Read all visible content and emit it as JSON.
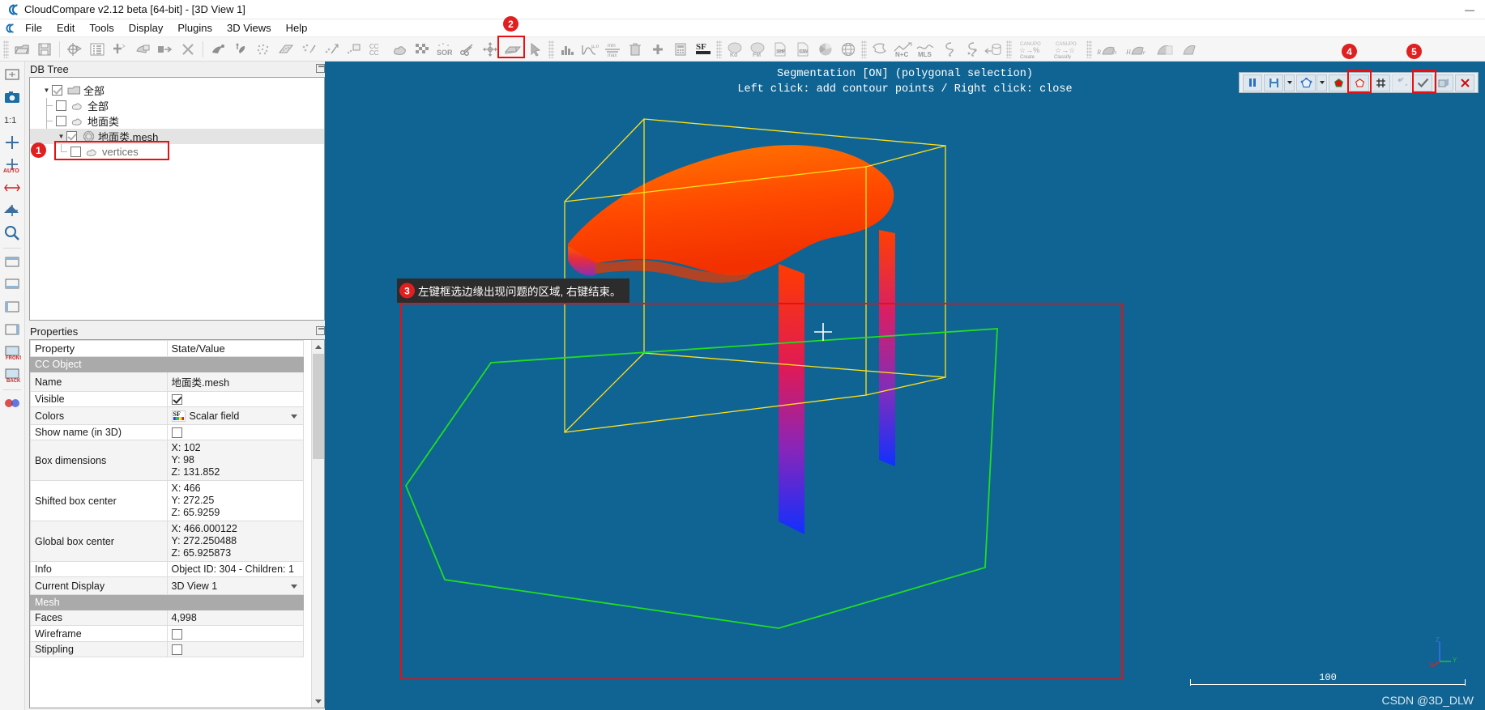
{
  "window": {
    "title": "CloudCompare v2.12 beta [64-bit] - [3D View 1]",
    "app_icon": "cloudcompare-logo-icon",
    "minimize": "—",
    "maximize": "▢",
    "close": "✕"
  },
  "menubar": {
    "icon": "cloudcompare-logo-icon",
    "items": [
      {
        "label": "File",
        "mnemonic": "F"
      },
      {
        "label": "Edit",
        "mnemonic": "E"
      },
      {
        "label": "Tools",
        "mnemonic": "T"
      },
      {
        "label": "Display",
        "mnemonic": "D"
      },
      {
        "label": "Plugins",
        "mnemonic": "P"
      },
      {
        "label": "3D Views",
        "mnemonic": "V"
      },
      {
        "label": "Help",
        "mnemonic": "H"
      }
    ]
  },
  "main_toolbar": {
    "groups": [
      {
        "buttons": [
          {
            "name": "open-file-icon"
          },
          {
            "name": "save-file-icon"
          }
        ]
      },
      {
        "buttons": [
          {
            "name": "global-shift-settings-icon"
          },
          {
            "name": "display-properties-icon"
          },
          {
            "name": "add-point-icon"
          },
          {
            "name": "clone-icon"
          },
          {
            "name": "merge-icon"
          },
          {
            "name": "delete-icon"
          }
        ]
      },
      {
        "buttons": [
          {
            "name": "subsample-icon"
          },
          {
            "name": "normals-icon"
          },
          {
            "name": "sample-points-icon"
          },
          {
            "name": "rasterize-icon"
          },
          {
            "name": "noise-filter-icon"
          },
          {
            "name": "compute-unroll-icon"
          },
          {
            "name": "fit-plane-icon"
          },
          {
            "name": "cloud-cloud-dist-icon"
          },
          {
            "name": "cloud-mesh-dist-icon"
          },
          {
            "name": "checkerboard-icon"
          },
          {
            "name": "sor-filter-icon"
          },
          {
            "name": "segment-scissors-icon",
            "highlighted": true
          },
          {
            "name": "translate-rotate-icon"
          },
          {
            "name": "section-box-icon"
          },
          {
            "name": "point-picking-icon"
          }
        ]
      },
      {
        "buttons": [
          {
            "name": "histogram-icon"
          },
          {
            "name": "gaussian-filter-icon"
          },
          {
            "name": "filter-by-value-icon"
          },
          {
            "name": "sf-gradient-icon"
          },
          {
            "name": "delete-sf-icon"
          },
          {
            "name": "add-sf-icon"
          },
          {
            "name": "sf-arithmetic-icon"
          },
          {
            "name": "sf-toolbar-icon"
          }
        ]
      },
      {
        "buttons": [
          {
            "name": "kd-tree-icon",
            "label": "Kd"
          },
          {
            "name": "fm-plugin-icon",
            "label": "FM"
          },
          {
            "name": "export-shp-icon",
            "label": "SHP"
          },
          {
            "name": "export-csv-icon",
            "label": "CSV"
          },
          {
            "name": "pie-chart-icon"
          },
          {
            "name": "globe-icon"
          }
        ]
      },
      {
        "buttons": [
          {
            "name": "puzzle-plugin-icon"
          },
          {
            "name": "normal-to-cloud-icon",
            "label": "N+C"
          },
          {
            "name": "mls-plugin-icon",
            "label": "MLS"
          },
          {
            "name": "curvature-icon"
          },
          {
            "name": "ransac-shape-detect-icon"
          },
          {
            "name": "unroll-cylinder-icon"
          }
        ]
      },
      {
        "buttons": [
          {
            "name": "canupo-create-icon",
            "label": "CANUPO Create"
          },
          {
            "name": "canupo-classify-icon",
            "label": "CANUPO Classify"
          }
        ]
      },
      {
        "buttons": [
          {
            "name": "rgb-render-icon",
            "label": "RGB"
          },
          {
            "name": "hsv-render-icon",
            "label": "HSV"
          },
          {
            "name": "shade-render-icon"
          },
          {
            "name": "ambient-render-icon"
          }
        ]
      }
    ]
  },
  "left_strip": {
    "buttons": [
      {
        "name": "zoom-global-icon"
      },
      {
        "name": "camera-snapshot-icon"
      },
      {
        "name": "zoom-1-1-icon",
        "label": "1:1"
      },
      {
        "name": "pivot-center-icon"
      },
      {
        "name": "auto-pivot-icon",
        "label": "AUTO"
      },
      {
        "name": "object-camera-mode-icon"
      },
      {
        "name": "pick-rotation-center-icon"
      },
      {
        "name": "zoom-window-icon"
      },
      {
        "name": "view-top-icon"
      },
      {
        "name": "view-bottom-icon"
      },
      {
        "name": "view-left-icon"
      },
      {
        "name": "view-right-icon"
      },
      {
        "name": "view-front-icon",
        "label": "FRONT"
      },
      {
        "name": "view-back-icon",
        "label": "BACK"
      },
      {
        "name": "stereo-mode-icon"
      }
    ]
  },
  "db_tree": {
    "title": "DB Tree",
    "float_icon": "undock-icon",
    "items": [
      {
        "label": "全部",
        "icon": "folder-icon",
        "checked": true,
        "expanded": true,
        "depth": 0,
        "selected": false,
        "checkbox_gray": true
      },
      {
        "label": "全部",
        "icon": "cloud-icon",
        "checked": false,
        "depth": 1,
        "selected": false
      },
      {
        "label": "地面类",
        "icon": "cloud-icon",
        "checked": false,
        "depth": 1,
        "selected": false
      },
      {
        "label": "地面类.mesh",
        "icon": "mesh-icon",
        "checked": true,
        "expanded": true,
        "depth": 1,
        "selected": true,
        "checkbox_gray": true
      },
      {
        "label": "vertices",
        "icon": "cloud-icon",
        "checked": false,
        "depth": 2,
        "selected": false
      }
    ]
  },
  "properties": {
    "title": "Properties",
    "float_icon": "undock-icon",
    "columns": [
      "Property",
      "State/Value"
    ],
    "rows": [
      {
        "type": "section",
        "label": "CC Object"
      },
      {
        "type": "text",
        "key": "Name",
        "value": "地面类.mesh"
      },
      {
        "type": "checkbox",
        "key": "Visible",
        "checked": true
      },
      {
        "type": "combo",
        "key": "Colors",
        "value": "Scalar field",
        "icon": "scalar-field-icon"
      },
      {
        "type": "checkbox",
        "key": "Show name (in 3D)",
        "checked": false
      },
      {
        "type": "multiline",
        "key": "Box dimensions",
        "lines": [
          "X: 102",
          "Y: 98",
          "Z: 131.852"
        ]
      },
      {
        "type": "multiline",
        "key": "Shifted box center",
        "lines": [
          "X: 466",
          "Y: 272.25",
          "Z: 65.9259"
        ]
      },
      {
        "type": "multiline",
        "key": "Global box center",
        "lines": [
          "X: 466.000122",
          "Y: 272.250488",
          "Z: 65.925873"
        ]
      },
      {
        "type": "text",
        "key": "Info",
        "value": "Object ID: 304 - Children: 1"
      },
      {
        "type": "combo",
        "key": "Current Display",
        "value": "3D View 1"
      },
      {
        "type": "section",
        "label": "Mesh"
      },
      {
        "type": "text",
        "key": "Faces",
        "value": "4,998"
      },
      {
        "type": "checkbox",
        "key": "Wireframe",
        "checked": false
      },
      {
        "type": "checkbox",
        "key": "Stippling",
        "checked": false
      }
    ]
  },
  "view3d": {
    "header_line1": "Segmentation [ON] (polygonal selection)",
    "header_line2": "Left click: add contour points / Right click: close",
    "background_color": "#0f6493",
    "cursor": "crosshair-cursor",
    "scale_value": "100",
    "watermark": "CSDN @3D_DLW",
    "axis_labels": {
      "z": "Z",
      "y": "Y",
      "x": "X"
    }
  },
  "segmentation_toolbar": {
    "buttons": [
      {
        "name": "pause-segmentation-button",
        "glyph": "pause",
        "highlighted": false
      },
      {
        "name": "save-segmentation-button",
        "glyph": "save",
        "highlighted": false
      },
      {
        "name": "save-dropdown-button",
        "glyph": "chevron-down",
        "highlighted": false
      },
      {
        "name": "polyline-selection-button",
        "glyph": "polygon-outline",
        "highlighted": false
      },
      {
        "name": "selection-dropdown-button",
        "glyph": "chevron-down",
        "highlighted": false
      },
      {
        "name": "segment-in-button",
        "glyph": "polygon-red-inside",
        "highlighted": false
      },
      {
        "name": "segment-out-button",
        "glyph": "polygon-red-outline",
        "highlighted": true,
        "marker": "4"
      },
      {
        "name": "use-existing-polyline-button",
        "glyph": "hash",
        "highlighted": false
      },
      {
        "name": "undo-button",
        "glyph": "undo",
        "highlighted": false,
        "disabled": true
      },
      {
        "name": "confirm-segmentation-button",
        "glyph": "check",
        "highlighted": true,
        "marker": "5"
      },
      {
        "name": "confirm-and-delete-button",
        "glyph": "export",
        "highlighted": false
      },
      {
        "name": "cancel-segmentation-button",
        "glyph": "cross",
        "highlighted": false
      }
    ]
  },
  "annotations": [
    {
      "id": "1",
      "marker": "1",
      "target": "db-tree-selected-mesh"
    },
    {
      "id": "2",
      "marker": "2",
      "target": "segment-scissors-toolbar-button"
    },
    {
      "id": "3",
      "marker": "3",
      "text": "左键框选边缘出现问题的区域, 右键结束。"
    },
    {
      "id": "4",
      "marker": "4",
      "target": "segment-out-button"
    },
    {
      "id": "5",
      "marker": "5",
      "target": "confirm-segmentation-button"
    },
    {
      "id": "selection-region",
      "marker": "",
      "target": "red-selection-rectangle"
    }
  ],
  "colors": {
    "accent_red": "#e02020",
    "view_background": "#0f6493",
    "bbox_yellow": "#ffe11a",
    "polyline_green": "#22dd22",
    "mesh_hot": "#ff5a00"
  }
}
